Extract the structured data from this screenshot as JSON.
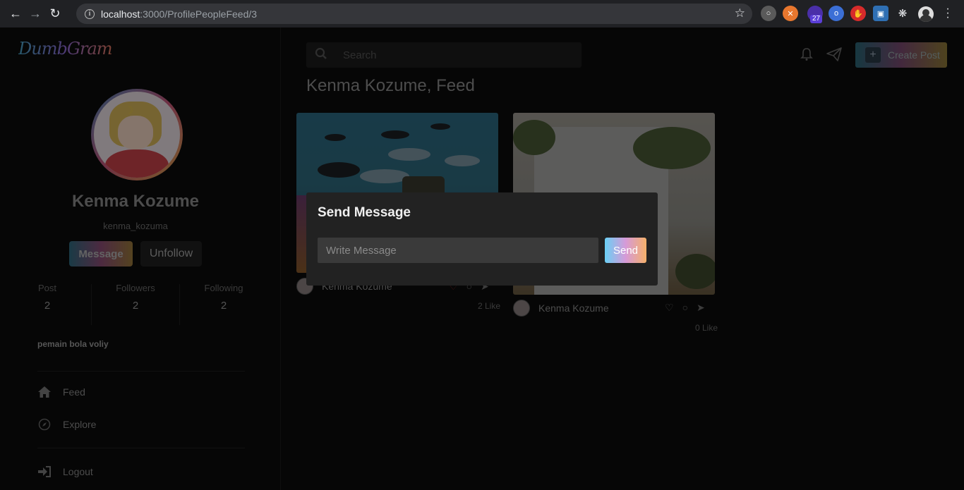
{
  "browser": {
    "url_host": "localhost",
    "url_path": ":3000/ProfilePeopleFeed/3",
    "extension_badge": "27"
  },
  "app": {
    "logo": "DumbGram"
  },
  "profile": {
    "name": "Kenma Kozume",
    "username": "kenma_kozuma",
    "message_button": "Message",
    "unfollow_button": "Unfollow",
    "stats": [
      {
        "label": "Post",
        "value": "2"
      },
      {
        "label": "Followers",
        "value": "2"
      },
      {
        "label": "Following",
        "value": "2"
      }
    ],
    "bio": "pemain bola voliy"
  },
  "menu": {
    "feed": "Feed",
    "explore": "Explore",
    "logout": "Logout"
  },
  "header": {
    "search_placeholder": "Search",
    "create_post": "Create Post"
  },
  "feed": {
    "title": "Kenma Kozume, Feed",
    "posts": [
      {
        "author": "Kenma Kozume",
        "likes": "2 Like"
      },
      {
        "author": "Kenma Kozume",
        "likes": "0 Like"
      }
    ]
  },
  "modal": {
    "title": "Send Message",
    "input_placeholder": "Write Message",
    "send_button": "Send"
  }
}
